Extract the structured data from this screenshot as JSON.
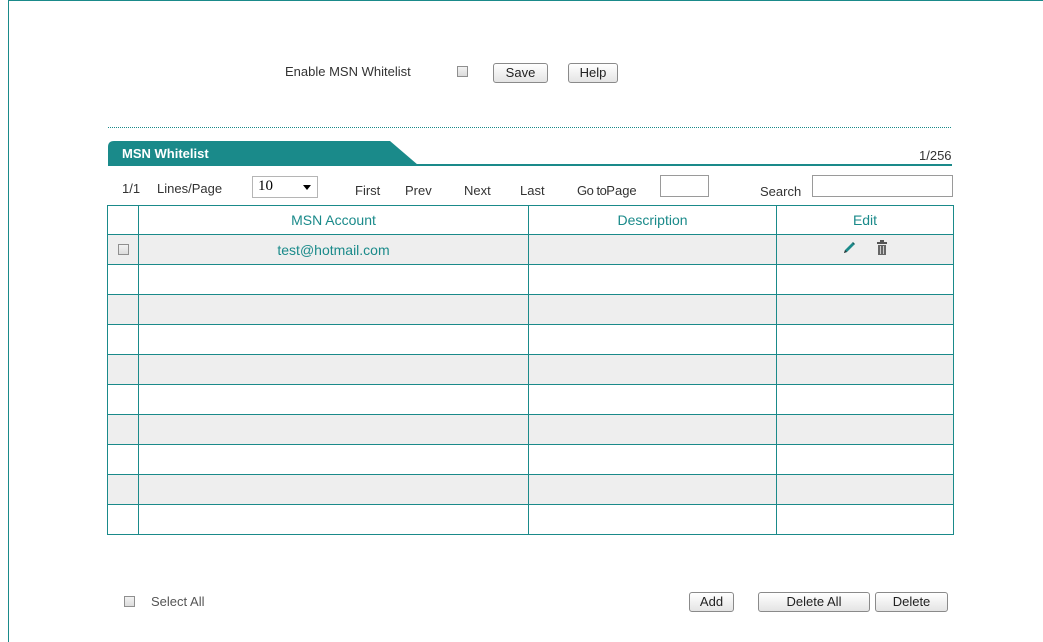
{
  "top": {
    "enable_label": "Enable MSN Whitelist",
    "enable_checked": false,
    "save_label": "Save",
    "help_label": "Help"
  },
  "panel": {
    "title": "MSN Whitelist",
    "count": "1/256"
  },
  "pager": {
    "page_indicator": "1/1",
    "lines_label": "Lines/Page",
    "lines_value": "10",
    "first": "First",
    "prev": "Prev",
    "next": "Next",
    "last": "Last",
    "goto_prefix": "Go to",
    "goto_suffix": "Page",
    "goto_value": "",
    "search_label": "Search",
    "search_value": ""
  },
  "table": {
    "headers": [
      "",
      "MSN Account",
      "Description",
      "Edit"
    ],
    "rows": [
      {
        "account": "test@hotmail.com",
        "description": "",
        "has_actions": true
      }
    ],
    "total_rows": 10
  },
  "footer": {
    "select_all_label": "Select All",
    "add_label": "Add",
    "delete_all_label": "Delete All",
    "delete_label": "Delete"
  },
  "colors": {
    "accent": "#1a8a8a",
    "row_alt": "#eeeeee"
  }
}
